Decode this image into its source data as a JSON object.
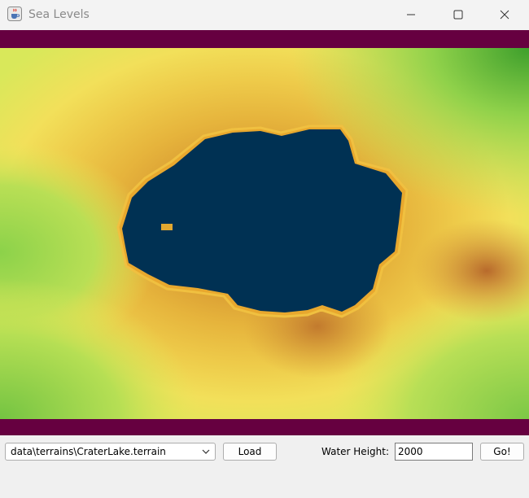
{
  "window": {
    "title": "Sea Levels",
    "icon": "java-cup-icon"
  },
  "canvas": {
    "border_color": "#660040",
    "water_color": "#003153",
    "terrain_colors": [
      "#f5e660",
      "#e8b83c",
      "#d49a2e",
      "#c47a30",
      "#9ad44a",
      "#4aa83a"
    ]
  },
  "controls": {
    "terrain_file": "data\\terrains\\CraterLake.terrain",
    "load_label": "Load",
    "water_height_label": "Water Height:",
    "water_height_value": "2000",
    "go_label": "Go!"
  }
}
